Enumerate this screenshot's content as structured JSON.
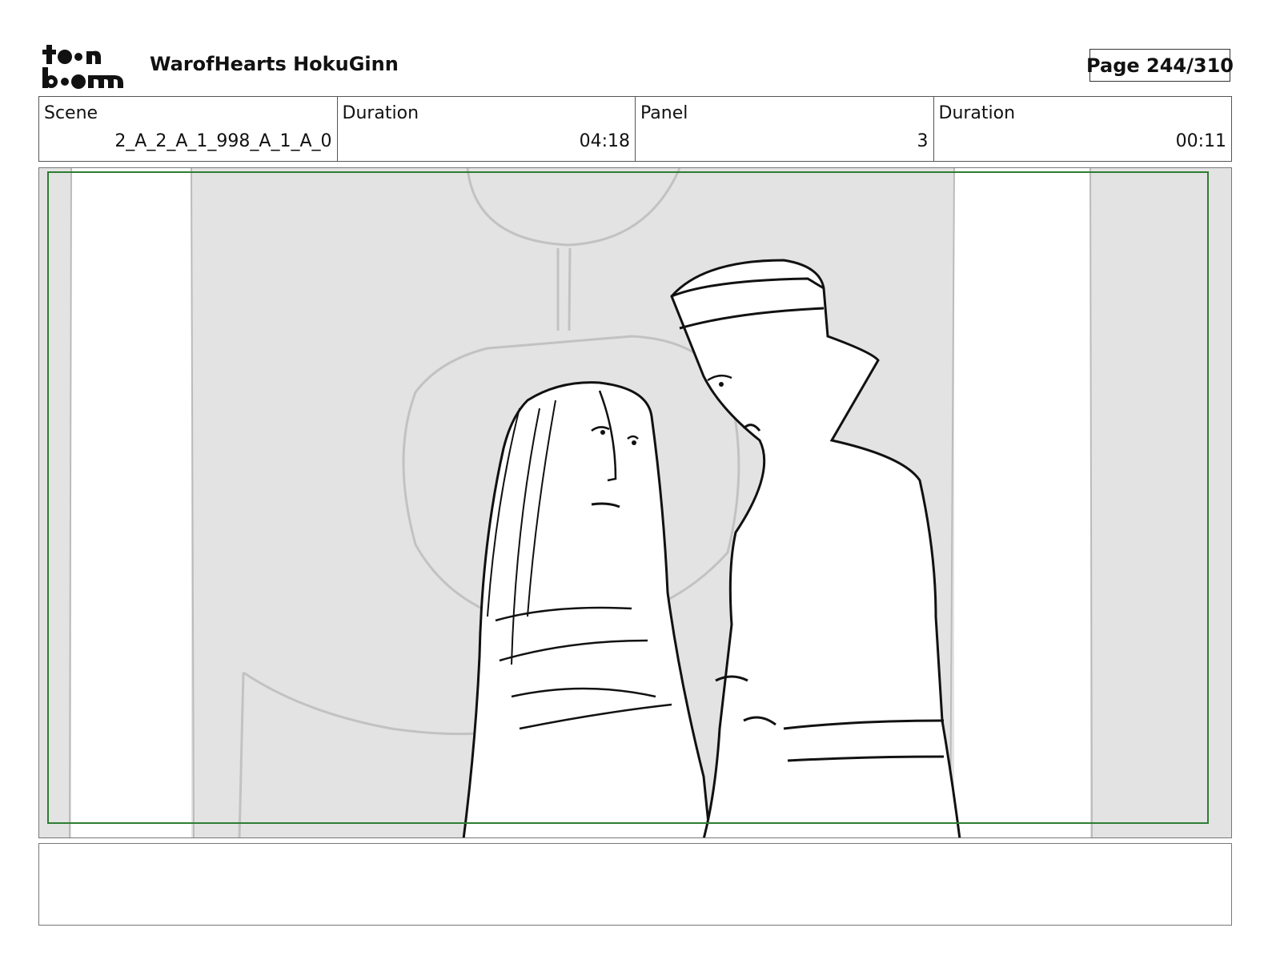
{
  "header": {
    "project_title": "WarofHearts HokuGinn",
    "page_label": "Page 244/310",
    "logo": {
      "icon": "toonboom-logo-icon",
      "lettering": "toon boom"
    }
  },
  "info": [
    {
      "label": "Scene",
      "value": "2_A_2_A_1_998_A_1_A_0"
    },
    {
      "label": "Duration",
      "value": "04:18"
    },
    {
      "label": "Panel",
      "value": "3"
    },
    {
      "label": "Duration",
      "value": "00:11"
    }
  ],
  "panel": {
    "frame_color": "#2e7d32",
    "description": "storyboard sketch"
  },
  "notes": {
    "text": ""
  }
}
